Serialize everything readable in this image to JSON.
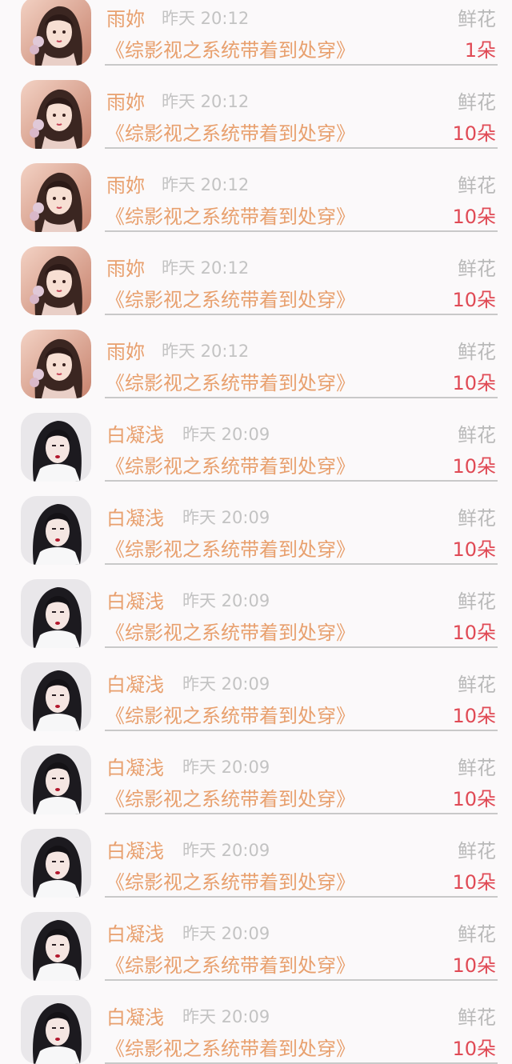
{
  "records": [
    {
      "name": "雨妳",
      "time": "昨天 20:12",
      "gift_type": "鲜花",
      "book": "《综影视之系统带着到处穿》",
      "count": "1朵",
      "avatar": "avatar-a"
    },
    {
      "name": "雨妳",
      "time": "昨天 20:12",
      "gift_type": "鲜花",
      "book": "《综影视之系统带着到处穿》",
      "count": "10朵",
      "avatar": "avatar-a"
    },
    {
      "name": "雨妳",
      "time": "昨天 20:12",
      "gift_type": "鲜花",
      "book": "《综影视之系统带着到处穿》",
      "count": "10朵",
      "avatar": "avatar-a"
    },
    {
      "name": "雨妳",
      "time": "昨天 20:12",
      "gift_type": "鲜花",
      "book": "《综影视之系统带着到处穿》",
      "count": "10朵",
      "avatar": "avatar-a"
    },
    {
      "name": "雨妳",
      "time": "昨天 20:12",
      "gift_type": "鲜花",
      "book": "《综影视之系统带着到处穿》",
      "count": "10朵",
      "avatar": "avatar-a"
    },
    {
      "name": "白凝浅",
      "time": "昨天 20:09",
      "gift_type": "鲜花",
      "book": "《综影视之系统带着到处穿》",
      "count": "10朵",
      "avatar": "avatar-b"
    },
    {
      "name": "白凝浅",
      "time": "昨天 20:09",
      "gift_type": "鲜花",
      "book": "《综影视之系统带着到处穿》",
      "count": "10朵",
      "avatar": "avatar-b"
    },
    {
      "name": "白凝浅",
      "time": "昨天 20:09",
      "gift_type": "鲜花",
      "book": "《综影视之系统带着到处穿》",
      "count": "10朵",
      "avatar": "avatar-b"
    },
    {
      "name": "白凝浅",
      "time": "昨天 20:09",
      "gift_type": "鲜花",
      "book": "《综影视之系统带着到处穿》",
      "count": "10朵",
      "avatar": "avatar-b"
    },
    {
      "name": "白凝浅",
      "time": "昨天 20:09",
      "gift_type": "鲜花",
      "book": "《综影视之系统带着到处穿》",
      "count": "10朵",
      "avatar": "avatar-b"
    },
    {
      "name": "白凝浅",
      "time": "昨天 20:09",
      "gift_type": "鲜花",
      "book": "《综影视之系统带着到处穿》",
      "count": "10朵",
      "avatar": "avatar-b"
    },
    {
      "name": "白凝浅",
      "time": "昨天 20:09",
      "gift_type": "鲜花",
      "book": "《综影视之系统带着到处穿》",
      "count": "10朵",
      "avatar": "avatar-b"
    },
    {
      "name": "白凝浅",
      "time": "昨天 20:09",
      "gift_type": "鲜花",
      "book": "《综影视之系统带着到处穿》",
      "count": "10朵",
      "avatar": "avatar-b"
    }
  ],
  "colors": {
    "accent": "#e8a06e",
    "count": "#e04a55",
    "muted": "#c3c3c3",
    "background": "#fbf9fa"
  }
}
